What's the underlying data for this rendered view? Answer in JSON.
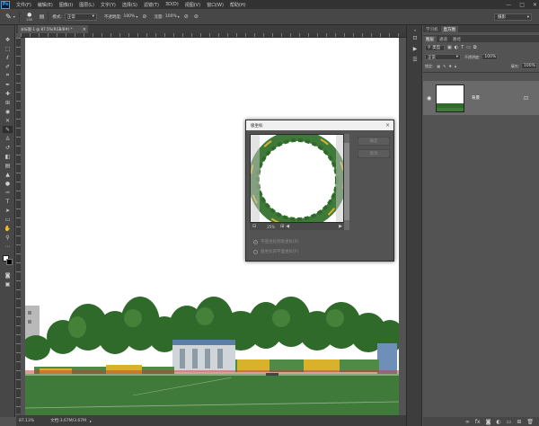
{
  "app": {
    "logo": "Ps"
  },
  "menu": [
    "文件(F)",
    "编辑(E)",
    "图像(I)",
    "图层(L)",
    "文字(Y)",
    "选择(S)",
    "滤镜(T)",
    "3D(D)",
    "视图(V)",
    "窗口(W)",
    "帮助(H)"
  ],
  "window_controls": {
    "minimize": "—",
    "maximize": "□",
    "close": "✕"
  },
  "options": {
    "brush_size": "200",
    "mode_label": "模式:",
    "mode_value": "正常",
    "opacity_label": "不透明度:",
    "opacity_value": "100%",
    "flow_label": "流量:",
    "flow_value": "100%",
    "workspace": "摄影"
  },
  "document": {
    "tab_title": "未标题-1 @ 87.5%(RGB/8#) *",
    "zoom": "87.13%",
    "doc_info": "文档:3.67M/3.67M"
  },
  "panels": {
    "top_tabs": [
      "学习机",
      "直方图"
    ],
    "layers_tabs": [
      "图层",
      "通道",
      "路径"
    ],
    "blend_mode": "正常",
    "opacity_label": "不透明度:",
    "opacity_value": "100%",
    "lock_label": "锁定:",
    "fill_label": "填充:",
    "fill_value": "100%",
    "filter_label": "类型",
    "layer_name": "背景"
  },
  "dialog": {
    "title": "极坐标",
    "ok_label": "确定",
    "cancel_label": "取消",
    "zoom_value": "25%",
    "option1": "平面坐标到极坐标(R)",
    "option2": "极坐标到平面坐标(P)",
    "selected_option": 1
  },
  "colors": {
    "app_bg": "#535353",
    "menubar": "#323232",
    "panel": "#474747",
    "accent_blue": "#31a8ff",
    "grass": "#3f7a3a",
    "stand_yellow": "#d9b12a"
  }
}
